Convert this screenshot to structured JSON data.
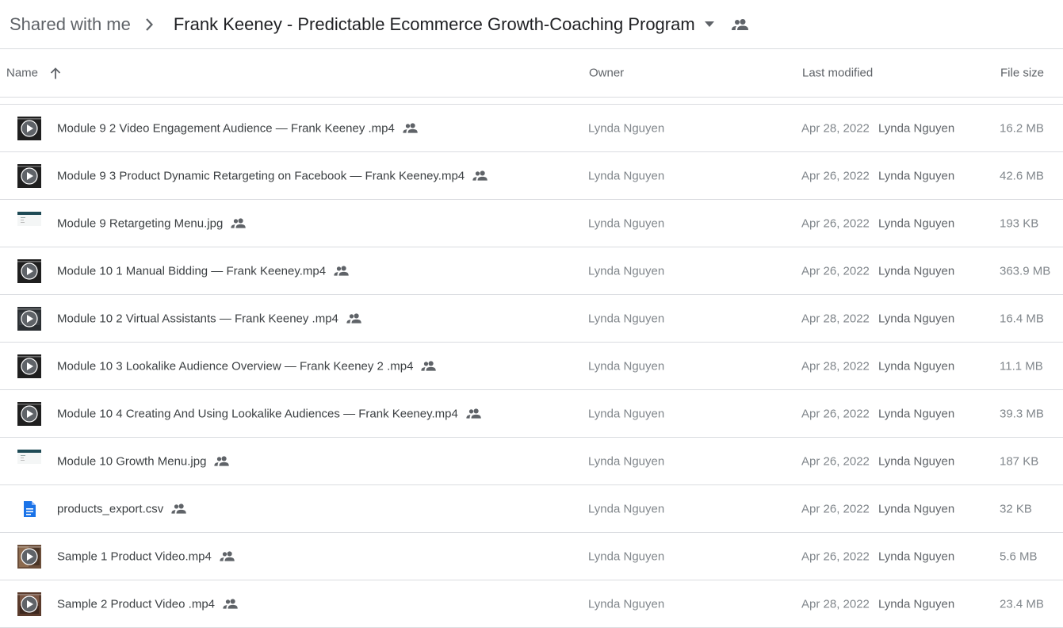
{
  "breadcrumb": {
    "root": "Shared with me",
    "current": "Frank Keeney - Predictable Ecommerce Growth-Coaching Program"
  },
  "columns": {
    "name": "Name",
    "owner": "Owner",
    "last_modified": "Last modified",
    "file_size": "File size"
  },
  "icons": {
    "breadcrumb_separator": "chevron-right-icon",
    "folder_menu": "caret-down-icon",
    "shared": "people-icon",
    "sort": "arrow-up-icon"
  },
  "colors": {
    "doc_blue": "#1a73e8",
    "video_frame": "#1f1f1f",
    "play_circle": "#5f6368"
  },
  "files": [
    {
      "name": "Module 9 2 Video Engagement Audience — Frank Keeney .mp4",
      "type": "video",
      "thumb": "black-play",
      "owner": "Lynda Nguyen",
      "modified_date": "Apr 28, 2022",
      "modified_by": "Lynda Nguyen",
      "size": "16.2 MB"
    },
    {
      "name": "Module 9 3 Product Dynamic Retargeting on Facebook — Frank Keeney.mp4",
      "type": "video",
      "thumb": "black-play",
      "owner": "Lynda Nguyen",
      "modified_date": "Apr 26, 2022",
      "modified_by": "Lynda Nguyen",
      "size": "42.6 MB"
    },
    {
      "name": "Module 9 Retargeting Menu.jpg",
      "type": "image",
      "thumb": "screenshot",
      "owner": "Lynda Nguyen",
      "modified_date": "Apr 26, 2022",
      "modified_by": "Lynda Nguyen",
      "size": "193 KB"
    },
    {
      "name": "Module 10 1 Manual Bidding — Frank Keeney.mp4",
      "type": "video",
      "thumb": "black-play",
      "owner": "Lynda Nguyen",
      "modified_date": "Apr 26, 2022",
      "modified_by": "Lynda Nguyen",
      "size": "363.9 MB"
    },
    {
      "name": "Module 10 2 Virtual Assistants — Frank Keeney .mp4",
      "type": "video",
      "thumb": "dark-play",
      "owner": "Lynda Nguyen",
      "modified_date": "Apr 28, 2022",
      "modified_by": "Lynda Nguyen",
      "size": "16.4 MB"
    },
    {
      "name": "Module 10 3 Lookalike Audience Overview — Frank Keeney 2 .mp4",
      "type": "video",
      "thumb": "black-play",
      "owner": "Lynda Nguyen",
      "modified_date": "Apr 28, 2022",
      "modified_by": "Lynda Nguyen",
      "size": "11.1 MB"
    },
    {
      "name": "Module 10 4 Creating And Using Lookalike Audiences — Frank Keeney.mp4",
      "type": "video",
      "thumb": "black-play",
      "owner": "Lynda Nguyen",
      "modified_date": "Apr 26, 2022",
      "modified_by": "Lynda Nguyen",
      "size": "39.3 MB"
    },
    {
      "name": "Module 10 Growth Menu.jpg",
      "type": "image",
      "thumb": "screenshot",
      "owner": "Lynda Nguyen",
      "modified_date": "Apr 26, 2022",
      "modified_by": "Lynda Nguyen",
      "size": "187 KB"
    },
    {
      "name": "products_export.csv",
      "type": "doc",
      "thumb": "doc",
      "owner": "Lynda Nguyen",
      "modified_date": "Apr 26, 2022",
      "modified_by": "Lynda Nguyen",
      "size": "32 KB"
    },
    {
      "name": "Sample 1 Product Video.mp4",
      "type": "video",
      "thumb": "photo-play",
      "owner": "Lynda Nguyen",
      "modified_date": "Apr 26, 2022",
      "modified_by": "Lynda Nguyen",
      "size": "5.6 MB"
    },
    {
      "name": "Sample 2 Product Video .mp4",
      "type": "video",
      "thumb": "photo-play-2",
      "owner": "Lynda Nguyen",
      "modified_date": "Apr 28, 2022",
      "modified_by": "Lynda Nguyen",
      "size": "23.4 MB"
    }
  ]
}
